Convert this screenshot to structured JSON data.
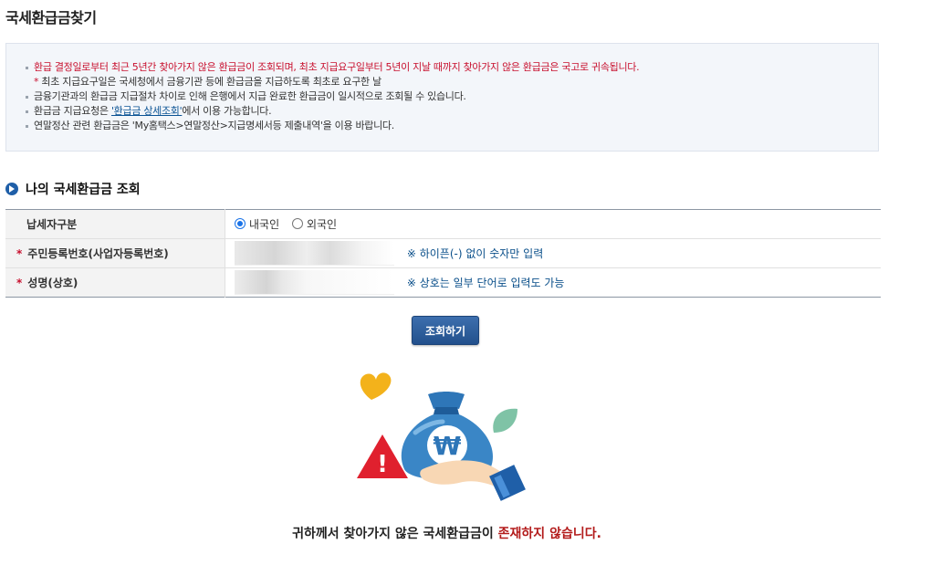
{
  "page": {
    "title": "국세환급금찾기"
  },
  "notice": {
    "line1": "환급 결정일로부터 최근 5년간 찾아가지 않은 환급금이 조회되며, 최초 지급요구일부터 5년이 지날 때까지 찾아가지 않은 환급금은 국고로 귀속됩니다.",
    "line1_sub_star": "*",
    "line1_sub": "최초 지급요구일은 국세청에서 금융기관 등에 환급금을 지급하도록 최초로 요구한 날",
    "line2": "금융기관과의 환급금 지급절차 차이로 인해 은행에서 지급 완료한 환급금이 일시적으로 조회될 수 있습니다.",
    "line3_prefix": "환급금 지급요청은 ",
    "line3_link": "'환급금 상세조회'",
    "line3_suffix": "에서 이용 가능합니다.",
    "line4": "연말정산 관련 환급금은 'My홈택스>연말정산>지급명세서등 제출내역'을 이용 바랍니다."
  },
  "section": {
    "title": "나의 국세환급금 조회"
  },
  "form": {
    "taxpayer_type": {
      "label": "납세자구분",
      "options": [
        "내국인",
        "외국인"
      ],
      "selected": "내국인"
    },
    "resident_number": {
      "required_mark": "*",
      "label": "주민등록번호(사업자등록번호)",
      "hint": "※ 하이픈(-) 없이 숫자만 입력"
    },
    "name": {
      "required_mark": "*",
      "label": "성명(상호)",
      "hint": "※ 상호는 일부 단어로 입력도 가능"
    }
  },
  "search_button": {
    "label": "조회하기"
  },
  "result": {
    "text_prefix": "귀하께서 찾아가지 않은 국세환급금이 ",
    "text_emphasis": "존재하지 않습니다."
  },
  "illustration": {
    "currency_symbol": "₩",
    "alert_symbol": "!"
  },
  "colors": {
    "accent": "#1f5fa8",
    "alert": "#c8102e",
    "button": "#2c5d9c"
  }
}
